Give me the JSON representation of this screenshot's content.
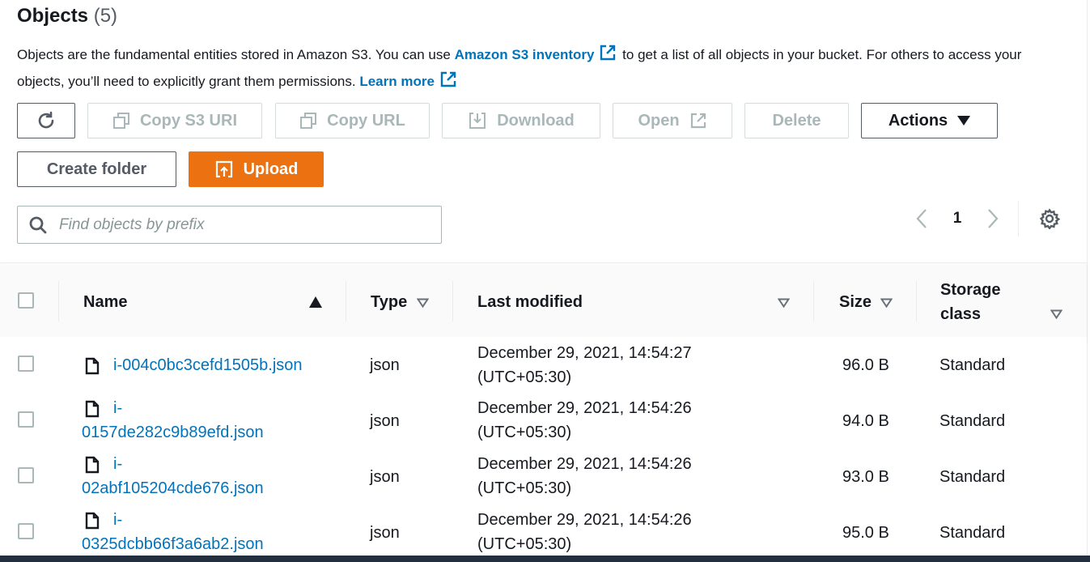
{
  "header": {
    "title": "Objects",
    "count": "(5)",
    "description_part1": "Objects are the fundamental entities stored in Amazon S3. You can use ",
    "inventory_link": "Amazon S3 inventory",
    "description_part2": " to get a list of all objects in your bucket. For others to access your objects, you’ll need to explicitly grant them permissions. ",
    "learn_more_link": "Learn more"
  },
  "toolbar": {
    "copy_s3_uri": "Copy S3 URI",
    "copy_url": "Copy URL",
    "download": "Download",
    "open": "Open",
    "delete": "Delete",
    "actions": "Actions",
    "create_folder": "Create folder",
    "upload": "Upload"
  },
  "search": {
    "placeholder": "Find objects by prefix",
    "value": ""
  },
  "pagination": {
    "current_page": "1"
  },
  "table": {
    "columns": {
      "name": "Name",
      "type": "Type",
      "last_modified": "Last modified",
      "size": "Size",
      "storage_class_line1": "Storage",
      "storage_class_line2": "class"
    },
    "rows": [
      {
        "name": "i-004c0bc3cefd1505b.json",
        "name_line1": "i-004c0bc3cefd1505b.json",
        "name_line2": "",
        "type": "json",
        "modified_date": "December 29, 2021, 14:54:27",
        "modified_tz": "(UTC+05:30)",
        "size": "96.0 B",
        "storage_class": "Standard"
      },
      {
        "name": "i-0157de282c9b89efd.json",
        "name_line1": "i-",
        "name_line2": "0157de282c9b89efd.json",
        "type": "json",
        "modified_date": "December 29, 2021, 14:54:26",
        "modified_tz": "(UTC+05:30)",
        "size": "94.0 B",
        "storage_class": "Standard"
      },
      {
        "name": "i-02abf105204cde676.json",
        "name_line1": "i-",
        "name_line2": "02abf105204cde676.json",
        "type": "json",
        "modified_date": "December 29, 2021, 14:54:26",
        "modified_tz": "(UTC+05:30)",
        "size": "93.0 B",
        "storage_class": "Standard"
      },
      {
        "name": "i-0325dcbb66f3a6ab2.json",
        "name_line1": "i-",
        "name_line2": "0325dcbb66f3a6ab2.json",
        "type": "json",
        "modified_date": "December 29, 2021, 14:54:26",
        "modified_tz": "(UTC+05:30)",
        "size": "95.0 B",
        "storage_class": "Standard"
      }
    ]
  },
  "icons": {
    "refresh": "refresh-icon",
    "copy": "copy-icon",
    "download": "download-icon",
    "external": "external-link-icon",
    "caret_down": "caret-down-icon",
    "upload": "upload-icon",
    "search": "search-icon",
    "settings": "gear-icon",
    "file": "file-icon"
  },
  "colors": {
    "link": "#0073bb",
    "primary_button": "#ec7211",
    "disabled_text": "#aab7b8",
    "border": "#545b64"
  }
}
